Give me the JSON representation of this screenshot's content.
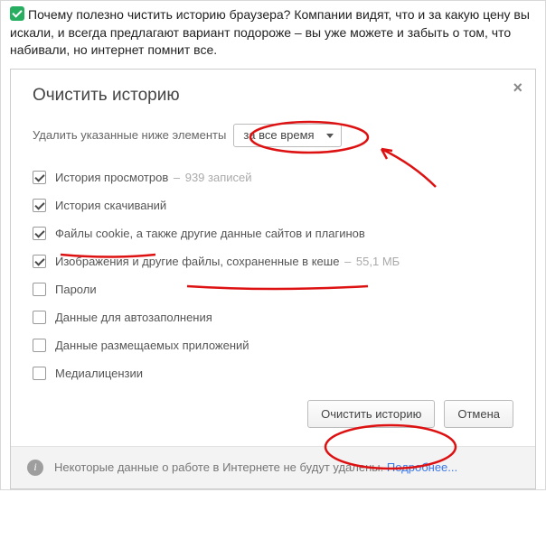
{
  "header": {
    "text": "Почему полезно чистить историю браузера? Компании видят, что и за какую цену вы искали, и всегда предлагают вариант подороже – вы уже можете и забыть о том, что набивали, но интернет помнит все."
  },
  "dialog": {
    "title": "Очистить историю",
    "select_label": "Удалить указанные ниже элементы",
    "select_value": "за все время",
    "options": [
      {
        "label": "История просмотров",
        "sub": "939 записей",
        "checked": true
      },
      {
        "label": "История скачиваний",
        "sub": "",
        "checked": true
      },
      {
        "label": "Файлы cookie, а также другие данные сайтов и плагинов",
        "sub": "",
        "checked": true
      },
      {
        "label": "Изображения и другие файлы, сохраненные в кеше",
        "sub": "55,1 МБ",
        "checked": true
      },
      {
        "label": "Пароли",
        "sub": "",
        "checked": false
      },
      {
        "label": "Данные для автозаполнения",
        "sub": "",
        "checked": false
      },
      {
        "label": "Данные размещаемых приложений",
        "sub": "",
        "checked": false
      },
      {
        "label": "Медиалицензии",
        "sub": "",
        "checked": false
      }
    ],
    "buttons": {
      "primary": "Очистить историю",
      "cancel": "Отмена"
    },
    "info": {
      "text": "Некоторые данные о работе в Интернете не будут удалены.",
      "link": "Подробнее..."
    }
  }
}
